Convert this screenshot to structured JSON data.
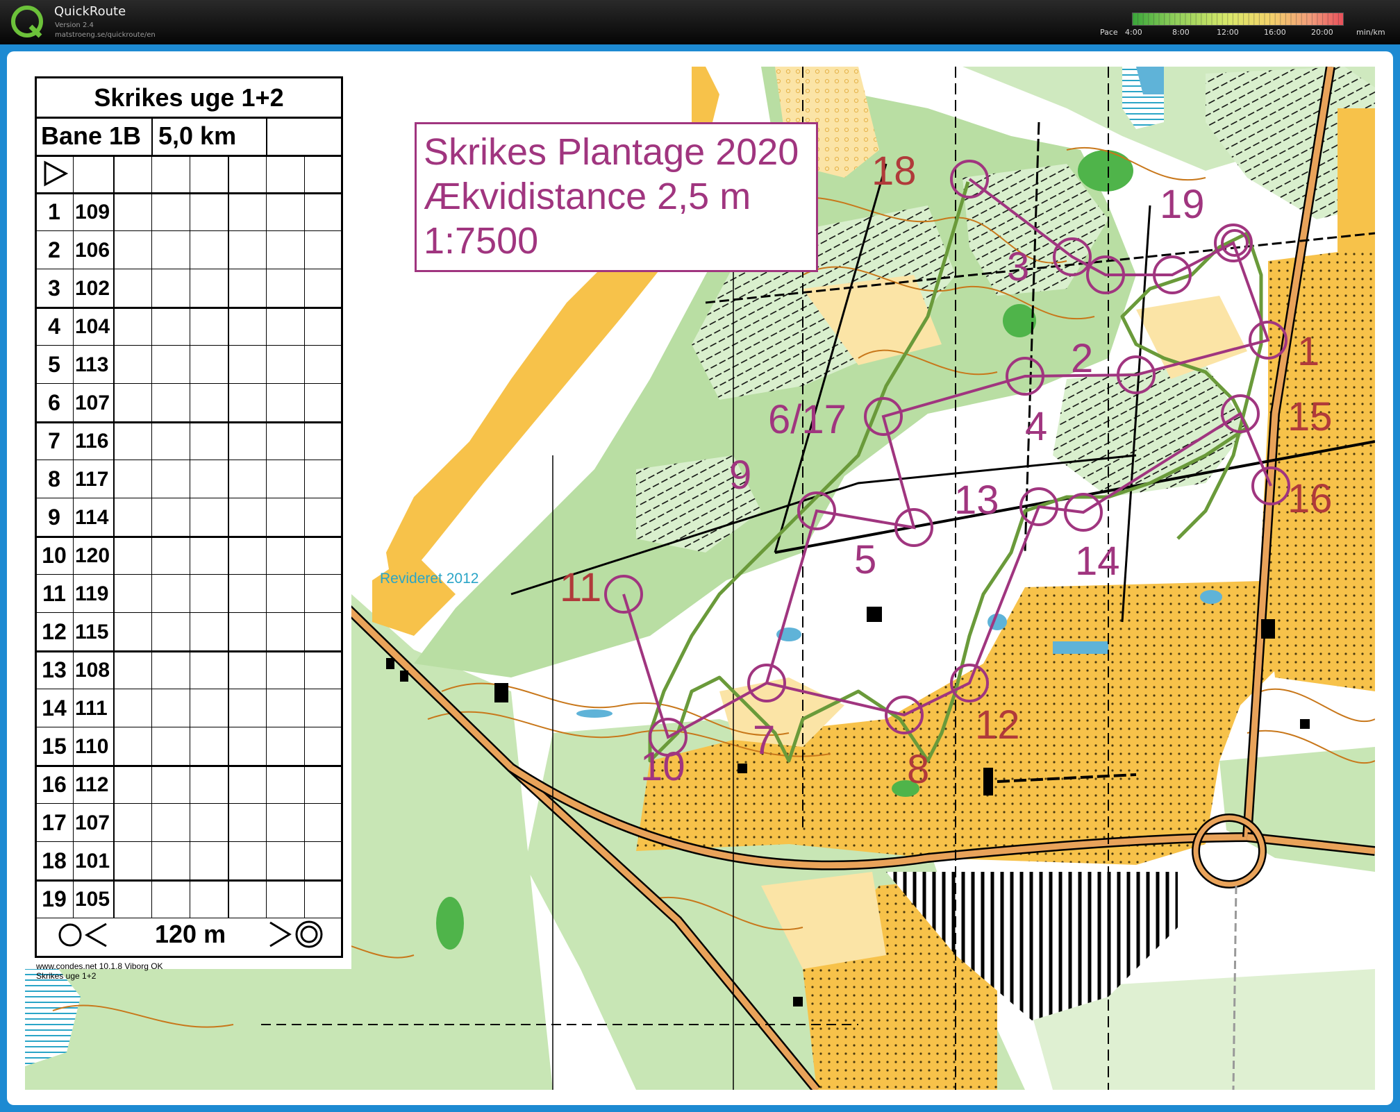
{
  "app": {
    "name": "QuickRoute",
    "version": "Version 2.4",
    "url": "matstroeng.se/quickroute/en"
  },
  "pace_legend": {
    "label": "Pace",
    "ticks": [
      "4:00",
      "8:00",
      "12:00",
      "16:00",
      "20:00"
    ],
    "unit": "min/km",
    "colors": [
      "#3aa63a",
      "#8fcf5a",
      "#d8e86a",
      "#f3d36a",
      "#f29a7a",
      "#e8505a"
    ]
  },
  "description_sheet": {
    "title": "Skrikes uge 1+2",
    "course_name": "Bane 1B",
    "course_length": "5,0 km",
    "controls": [
      {
        "num": "1",
        "code": "109"
      },
      {
        "num": "2",
        "code": "106"
      },
      {
        "num": "3",
        "code": "102"
      },
      {
        "num": "4",
        "code": "104"
      },
      {
        "num": "5",
        "code": "113"
      },
      {
        "num": "6",
        "code": "107"
      },
      {
        "num": "7",
        "code": "116"
      },
      {
        "num": "8",
        "code": "117"
      },
      {
        "num": "9",
        "code": "114"
      },
      {
        "num": "10",
        "code": "120"
      },
      {
        "num": "11",
        "code": "119"
      },
      {
        "num": "12",
        "code": "115"
      },
      {
        "num": "13",
        "code": "108"
      },
      {
        "num": "14",
        "code": "111"
      },
      {
        "num": "15",
        "code": "110"
      },
      {
        "num": "16",
        "code": "112"
      },
      {
        "num": "17",
        "code": "107"
      },
      {
        "num": "18",
        "code": "101"
      },
      {
        "num": "19",
        "code": "105"
      }
    ],
    "finish_distance": "120 m",
    "credit_line1": "www.condes.net 10.1.8 Viborg OK",
    "credit_line2": "Skrikes uge 1+2"
  },
  "map_title": {
    "line1": "Skrikes Plantage 2020",
    "line2": "Ækvidistance 2,5 m",
    "line3": "1:7500"
  },
  "revision_note": "Revideret 2012",
  "control_labels": [
    "18",
    "19",
    "3",
    "2",
    "1",
    "15",
    "4",
    "6/17",
    "9",
    "16",
    "13",
    "5",
    "14",
    "11",
    "12",
    "7",
    "10",
    "8"
  ],
  "colors": {
    "course_purple": "#a0357f",
    "frame_blue": "#1d8ad2",
    "map_open_yellow": "#f7c24a",
    "map_forest_green": "#b9dea3",
    "route_green": "#6a9a3a"
  }
}
